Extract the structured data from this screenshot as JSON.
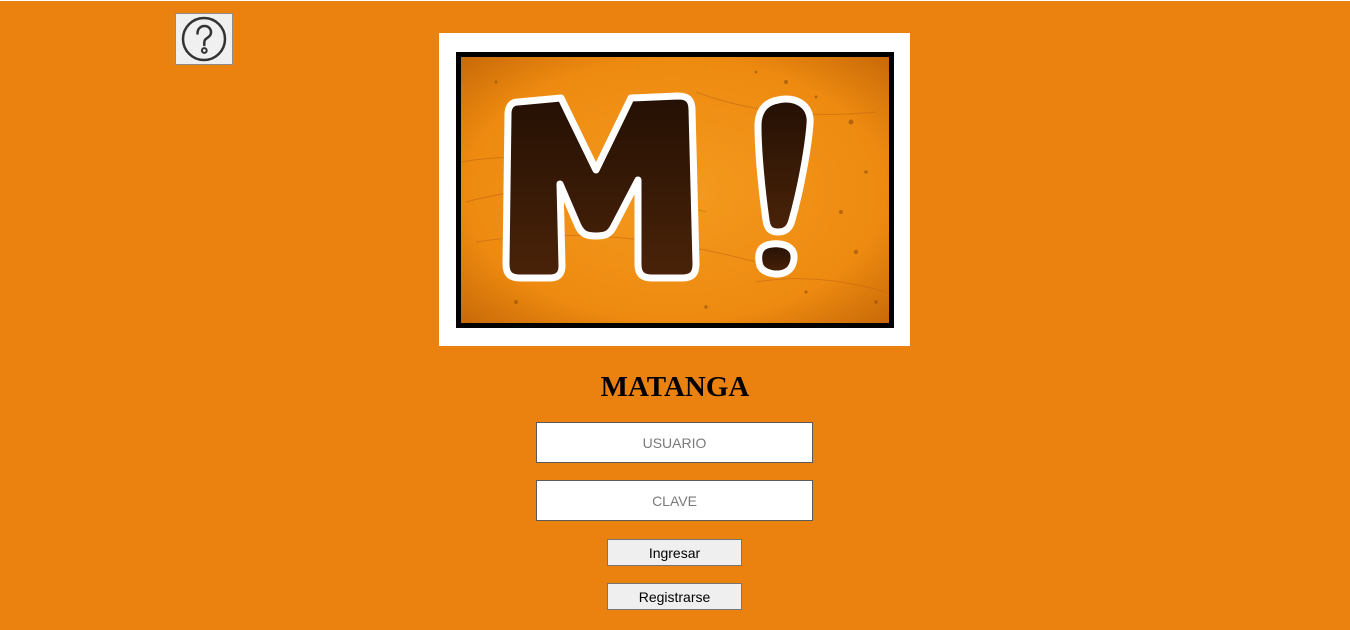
{
  "help": {
    "icon": "question-circle-icon"
  },
  "logo": {
    "text": "M!",
    "background_color": "#ef8c12",
    "letter_fill": "#3a1b05",
    "letter_outline": "#ffffff"
  },
  "brand": {
    "title": "MATANGA"
  },
  "login_form": {
    "username_placeholder": "USUARIO",
    "username_value": "",
    "password_placeholder": "CLAVE",
    "password_value": "",
    "login_label": "Ingresar",
    "register_label": "Registrarse"
  },
  "colors": {
    "page_background": "#eb8210",
    "button_background": "#efefef"
  }
}
